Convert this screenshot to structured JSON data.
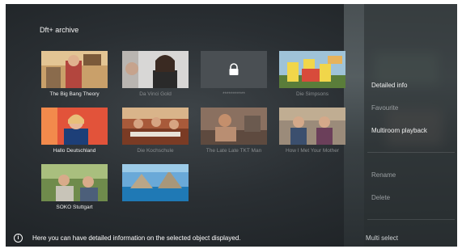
{
  "header": {
    "title": "Dft+ archive"
  },
  "grid": {
    "items": [
      {
        "caption": "The Big Bang Theory"
      },
      {
        "caption": "Da Vinci Gold"
      },
      {
        "caption": "***********"
      },
      {
        "caption": "Die Simpsons"
      },
      {
        "caption": "Hallo Deutschland"
      },
      {
        "caption": "Die Kochschule"
      },
      {
        "caption": "The Late Late TKT Man"
      },
      {
        "caption": "How I Met Your Mother"
      },
      {
        "caption": "SOKO Stuttgart"
      },
      {
        "caption": ""
      }
    ]
  },
  "menu": {
    "items": [
      {
        "label": "Detailed info"
      },
      {
        "label": "Favourite"
      },
      {
        "label": "Multiroom playback"
      },
      {
        "label": "Rename"
      },
      {
        "label": "Delete"
      },
      {
        "label": "Multi select"
      }
    ]
  },
  "footer": {
    "info_text": "Here you can have detailed information on the selected object displayed."
  },
  "icons": {
    "lock": "lock-icon",
    "info": "info-icon"
  }
}
